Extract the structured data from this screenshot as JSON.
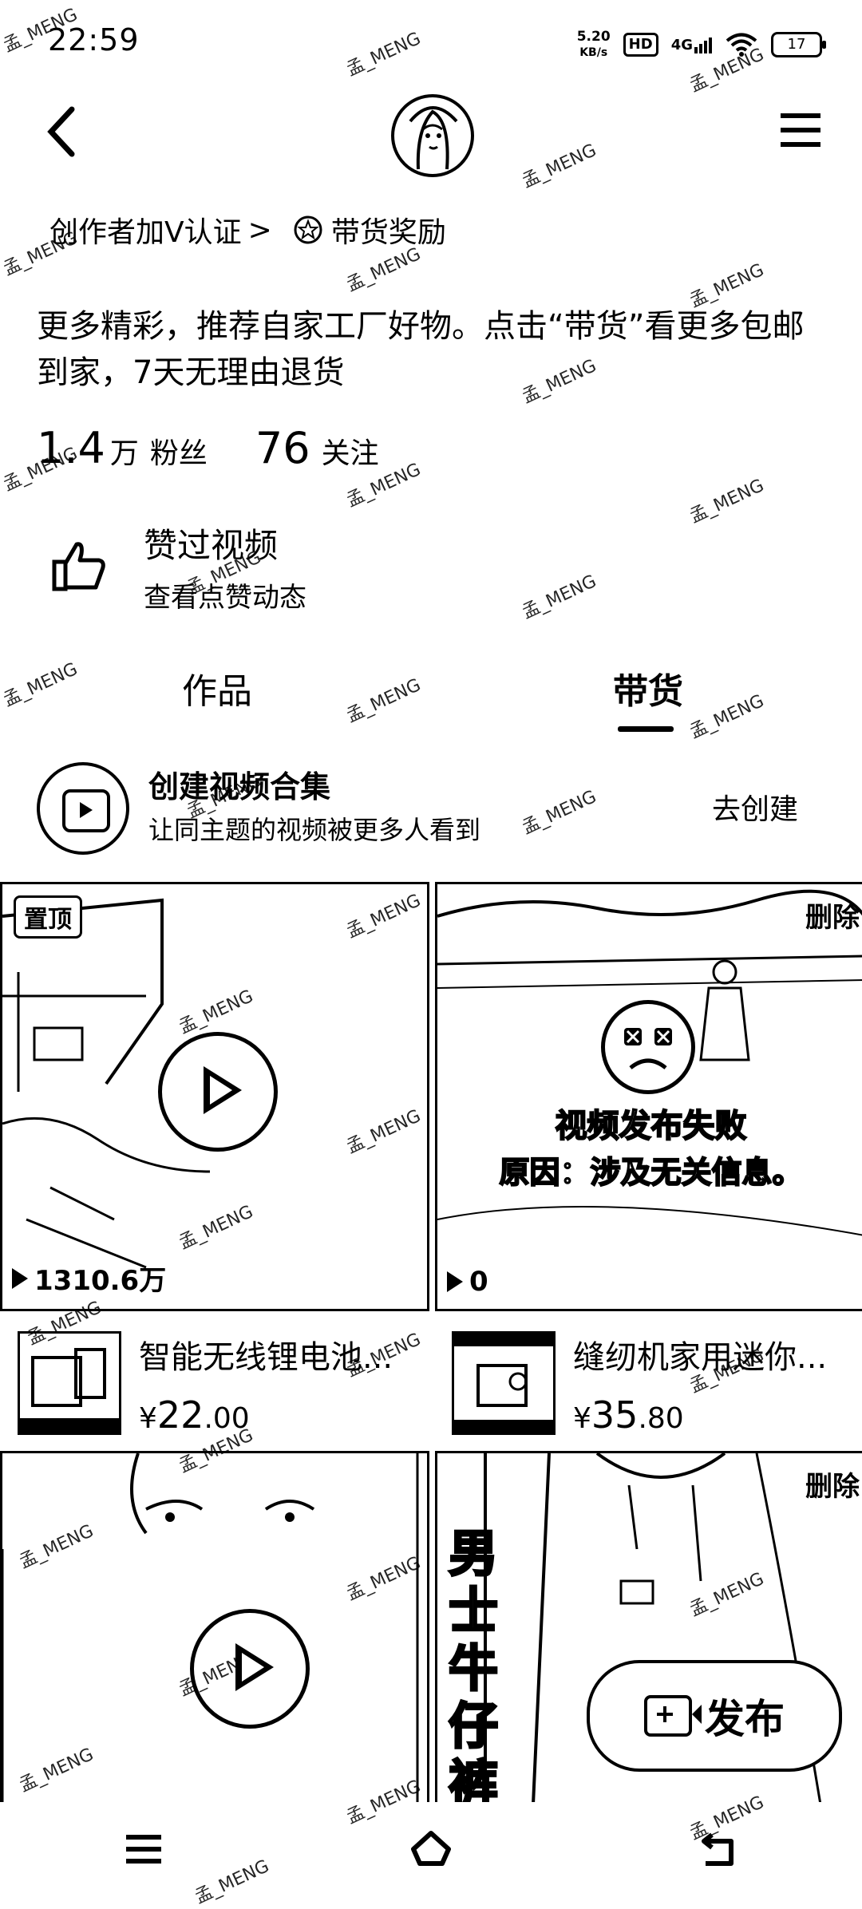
{
  "status_bar": {
    "time": "22:59",
    "net_speed_value": "5.20",
    "net_speed_unit": "KB/s",
    "hd": "HD",
    "signal": "4G",
    "battery": "17"
  },
  "profile": {
    "creator_verify": "创作者加V认证",
    "creator_verify_arrow": ">",
    "reward_label": "带货奖励",
    "bio": "更多精彩，推荐自家工厂好物。点击“带货”看更多包邮到家，7天无理由退货",
    "followers_count": "1.4",
    "followers_unit": "万",
    "followers_label": "粉丝",
    "following_count": "76",
    "following_label": "关注"
  },
  "liked": {
    "title": "赞过视频",
    "subtitle": "查看点赞动态"
  },
  "tabs": {
    "works": "作品",
    "goods": "带货"
  },
  "collection": {
    "title": "创建视频合集",
    "subtitle": "让同主题的视频被更多人看到",
    "action": "去创建"
  },
  "videos": [
    {
      "badge": "置顶",
      "views": "1310.6万"
    },
    {
      "badge": "删除",
      "fail_title": "视频发布失败",
      "fail_reason": "原因：涉及无关信息。",
      "views": "0"
    },
    {},
    {
      "badge": "删除",
      "overlay_text": "男士牛仔裤"
    }
  ],
  "products": [
    {
      "name": "智能无线锂电池...",
      "currency": "¥",
      "price_int": "22",
      "price_dec": ".00"
    },
    {
      "name": "缝纫机家用迷你...",
      "currency": "¥",
      "price_int": "35",
      "price_dec": ".80"
    }
  ],
  "fab": {
    "label": "发布"
  },
  "watermark": "孟_MENG"
}
